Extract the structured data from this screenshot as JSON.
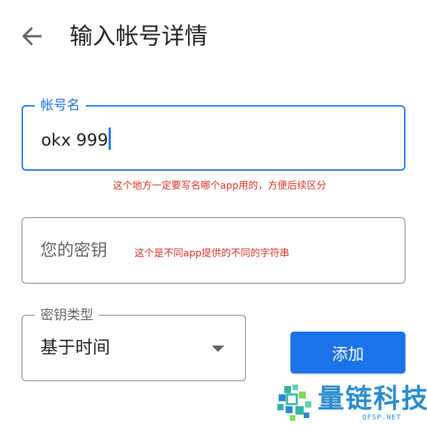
{
  "header": {
    "title": "输入帐号详情"
  },
  "account_name_field": {
    "label": "帐号名",
    "value": "okx 999",
    "note": "这个地方一定要写名哪个app用的，方便后续区分"
  },
  "secret_key_field": {
    "placeholder": "您的密钥",
    "note": "这个是不同app提供的不同的字符串"
  },
  "key_type_select": {
    "label": "密钥类型",
    "selected": "基于时间"
  },
  "add_button": {
    "label": "添加"
  },
  "watermark": {
    "title": "量链科技",
    "subtitle": "QFSP.NET"
  },
  "colors": {
    "accent": "#1a73e8",
    "note_red": "#d93025",
    "text_primary": "#202124",
    "text_secondary": "#5f6368",
    "watermark_blue": "#2a8bd0"
  },
  "icons": {
    "back": "arrow-left-icon",
    "dropdown": "triangle-down-icon",
    "watermark_logo": "mosaic-logo-icon"
  }
}
